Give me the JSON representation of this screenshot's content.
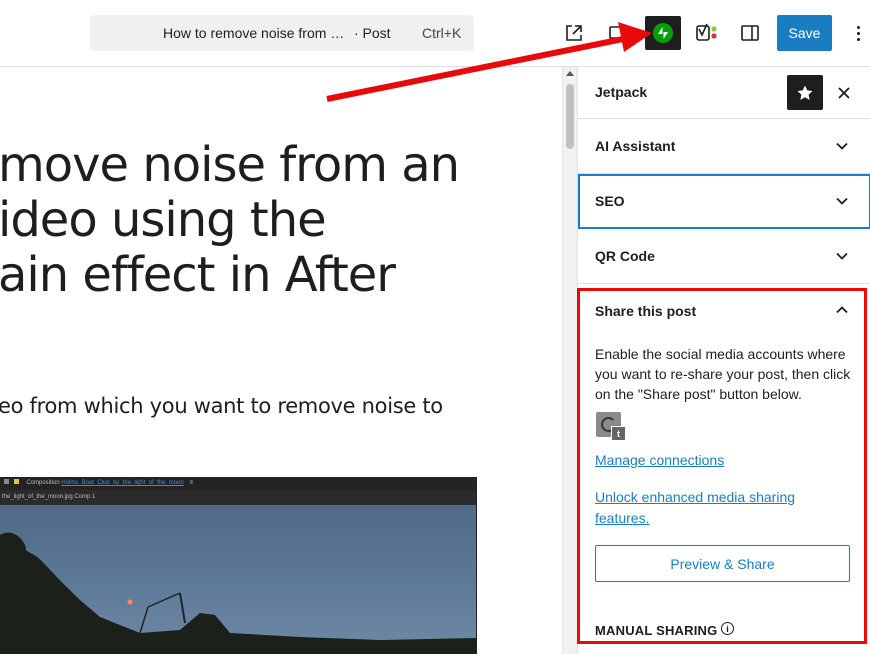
{
  "topbar": {
    "command_title": "How to remove noise from …",
    "command_type": "· Post",
    "command_shortcut": "Ctrl+K",
    "save_label": "Save"
  },
  "canvas": {
    "title": "move noise from an\nideo using the\nain effect in After",
    "paragraph": "eo from which you want to remove noise to",
    "image": {
      "composition_label": "Composition",
      "composition_name": "Holms_Boat_Club_by_the_light_of_the_moon",
      "comp_tab": "the_light_of_the_moon.jpg Comp 1"
    }
  },
  "sidebar": {
    "title": "Jetpack",
    "panels": [
      {
        "label": "AI Assistant",
        "expanded": false
      },
      {
        "label": "SEO",
        "expanded": false,
        "focused": true
      },
      {
        "label": "QR Code",
        "expanded": false
      },
      {
        "label": "Share this post",
        "expanded": true
      }
    ],
    "share": {
      "description": "Enable the social media accounts where you want to re-share your post, then click on the \"Share post\" button below.",
      "avatar_badge": "t",
      "manage_link": "Manage connections",
      "unlock_link": "Unlock enhanced media sharing features.",
      "preview_button": "Preview & Share",
      "manual_label": "MANUAL SHARING"
    }
  },
  "colors": {
    "accent": "#1a7dc2",
    "jetpack_green": "#069e08",
    "annotation_red": "#e8090d"
  }
}
